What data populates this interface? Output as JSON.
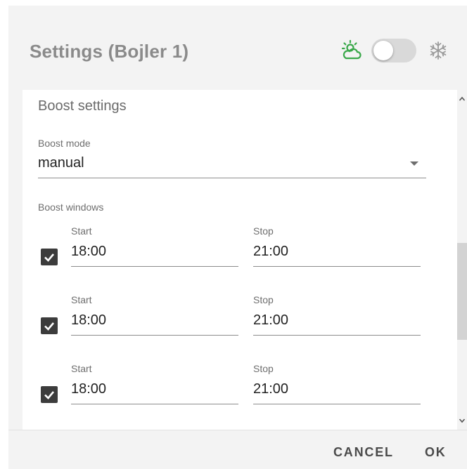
{
  "dialog": {
    "title": "Settings (Bojler 1)",
    "mode_toggle_on": false
  },
  "icons": {
    "weather": "sun-cloud-icon",
    "winter": "snowflake-icon"
  },
  "colors": {
    "weather_icon": "#3aa84a",
    "snow_icon": "#9a9a9a",
    "checkbox": "#3c3c3c"
  },
  "boost": {
    "section_title": "Boost settings",
    "mode_label": "Boost mode",
    "mode_value": "manual",
    "windows_label": "Boost windows",
    "windows": [
      {
        "enabled": true,
        "start_label": "Start",
        "start": "18:00",
        "stop_label": "Stop",
        "stop": "21:00"
      },
      {
        "enabled": true,
        "start_label": "Start",
        "start": "18:00",
        "stop_label": "Stop",
        "stop": "21:00"
      },
      {
        "enabled": true,
        "start_label": "Start",
        "start": "18:00",
        "stop_label": "Stop",
        "stop": "21:00"
      }
    ]
  },
  "actions": {
    "cancel": "CANCEL",
    "ok": "OK"
  }
}
